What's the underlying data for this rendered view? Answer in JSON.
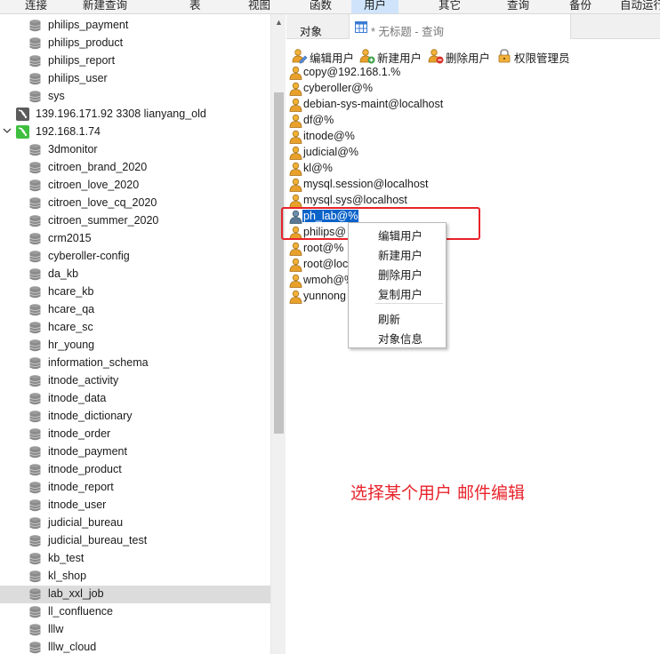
{
  "toolbar": {
    "items": [
      "连接",
      "新建查询",
      "表",
      "视图",
      "函数",
      "用户",
      "其它",
      "查询",
      "备份",
      "自动运行"
    ],
    "active_index": 5
  },
  "tree": {
    "items": [
      {
        "type": "db",
        "label": "philips_payment"
      },
      {
        "type": "db",
        "label": "philips_product"
      },
      {
        "type": "db",
        "label": "philips_report"
      },
      {
        "type": "db",
        "label": "philips_user"
      },
      {
        "type": "db",
        "label": "sys"
      },
      {
        "type": "server",
        "label": "139.196.171.92 3308 lianyang_old",
        "status": "disconnected"
      },
      {
        "type": "server",
        "label": "192.168.1.74",
        "status": "connected",
        "expanded": true
      },
      {
        "type": "db",
        "label": "3dmonitor"
      },
      {
        "type": "db",
        "label": "citroen_brand_2020"
      },
      {
        "type": "db",
        "label": "citroen_love_2020"
      },
      {
        "type": "db",
        "label": "citroen_love_cq_2020"
      },
      {
        "type": "db",
        "label": "citroen_summer_2020"
      },
      {
        "type": "db",
        "label": "crm2015"
      },
      {
        "type": "db",
        "label": "cyberoller-config"
      },
      {
        "type": "db",
        "label": "da_kb"
      },
      {
        "type": "db",
        "label": "hcare_kb"
      },
      {
        "type": "db",
        "label": "hcare_qa"
      },
      {
        "type": "db",
        "label": "hcare_sc"
      },
      {
        "type": "db",
        "label": "hr_young"
      },
      {
        "type": "db",
        "label": "information_schema"
      },
      {
        "type": "db",
        "label": "itnode_activity"
      },
      {
        "type": "db",
        "label": "itnode_data"
      },
      {
        "type": "db",
        "label": "itnode_dictionary"
      },
      {
        "type": "db",
        "label": "itnode_order"
      },
      {
        "type": "db",
        "label": "itnode_payment"
      },
      {
        "type": "db",
        "label": "itnode_product"
      },
      {
        "type": "db",
        "label": "itnode_report"
      },
      {
        "type": "db",
        "label": "itnode_user"
      },
      {
        "type": "db",
        "label": "judicial_bureau"
      },
      {
        "type": "db",
        "label": "judicial_bureau_test"
      },
      {
        "type": "db",
        "label": "kb_test"
      },
      {
        "type": "db",
        "label": "kl_shop"
      },
      {
        "type": "db",
        "label": "lab_xxl_job",
        "selected": true
      },
      {
        "type": "db",
        "label": "ll_confluence"
      },
      {
        "type": "db",
        "label": "lllw"
      },
      {
        "type": "db",
        "label": "lllw_cloud"
      }
    ]
  },
  "tabs": {
    "objects_label": "对象",
    "query_label": "* 无标题 - 查询"
  },
  "user_toolbar": {
    "edit_label": "编辑用户",
    "new_label": "新建用户",
    "delete_label": "删除用户",
    "privilege_label": "权限管理员"
  },
  "users": [
    {
      "label": "copy@192.168.1.%"
    },
    {
      "label": "cyberoller@%"
    },
    {
      "label": "debian-sys-maint@localhost"
    },
    {
      "label": "df@%"
    },
    {
      "label": "itnode@%"
    },
    {
      "label": "judicial@%"
    },
    {
      "label": "kl@%"
    },
    {
      "label": "mysql.session@localhost"
    },
    {
      "label": "mysql.sys@localhost"
    },
    {
      "label": "ph_lab@%",
      "selected": true
    },
    {
      "label": "philips@"
    },
    {
      "label": "root@%"
    },
    {
      "label": "root@loc"
    },
    {
      "label": "wmoh@%"
    },
    {
      "label": "yunnong"
    }
  ],
  "context_menu": {
    "edit": "编辑用户",
    "new": "新建用户",
    "delete": "删除用户",
    "copy": "复制用户",
    "refresh": "刷新",
    "info": "对象信息"
  },
  "annotation": {
    "text": "选择某个用户 邮件编辑",
    "color": "#e8232b"
  },
  "colors": {
    "selection_blue": "#0a63c9",
    "active_tab": "#cfe4fb",
    "tree_selected": "#dcdcdc",
    "annotation_red": "#e8232b"
  }
}
